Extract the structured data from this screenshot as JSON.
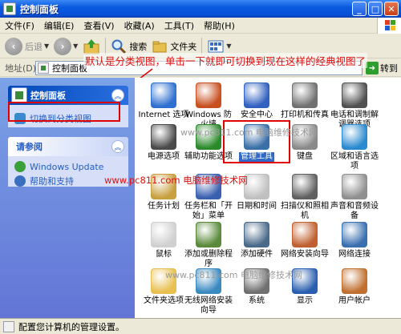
{
  "window": {
    "title": "控制面板"
  },
  "menu": [
    "文件(F)",
    "编辑(E)",
    "查看(V)",
    "收藏(A)",
    "工具(T)",
    "帮助(H)"
  ],
  "toolbar": {
    "back": "后退",
    "search": "搜索",
    "folders": "文件夹"
  },
  "address": {
    "label": "地址(D)",
    "value": "控制面板",
    "go": "转到"
  },
  "annotation": "默认是分类视图，单击一下就即可切换到现在这样的经典视图了",
  "left": {
    "control_panel": {
      "title": "控制面板",
      "link": "切换到分类视图"
    },
    "see_also": {
      "title": "请参阅",
      "links": [
        "Windows Update",
        "帮助和支持"
      ]
    }
  },
  "items": [
    {
      "label": "Internet 选项",
      "color": "#2E6FD0",
      "row": 0,
      "col": 0
    },
    {
      "label": "Windows 防火墙",
      "color": "#C85020",
      "row": 0,
      "col": 1
    },
    {
      "label": "安全中心",
      "color": "#3060C0",
      "row": 0,
      "col": 2
    },
    {
      "label": "打印机和传真",
      "color": "#707070",
      "row": 0,
      "col": 3
    },
    {
      "label": "电话和调制解调器选项",
      "color": "#505050",
      "row": 0,
      "col": 4
    },
    {
      "label": "电源选项",
      "color": "#4A4A4A",
      "row": 1,
      "col": 0
    },
    {
      "label": "辅助功能选项",
      "color": "#2C8A2C",
      "row": 1,
      "col": 1
    },
    {
      "label": "管理工具",
      "color": "#3A6FA8",
      "row": 1,
      "col": 2
    },
    {
      "label": "键盘",
      "color": "#8A8A8A",
      "row": 1,
      "col": 3
    },
    {
      "label": "区域和语言选项",
      "color": "#2A8ACF",
      "row": 1,
      "col": 4
    },
    {
      "label": "任务计划",
      "color": "#C8A040",
      "row": 2,
      "col": 0
    },
    {
      "label": "任务栏和「开始」菜单",
      "color": "#3A60B0",
      "row": 2,
      "col": 1
    },
    {
      "label": "日期和时间",
      "color": "#C0C0C0",
      "row": 2,
      "col": 2
    },
    {
      "label": "扫描仪和照相机",
      "color": "#606060",
      "row": 2,
      "col": 3
    },
    {
      "label": "声音和音频设备",
      "color": "#909090",
      "row": 2,
      "col": 4
    },
    {
      "label": "鼠标",
      "color": "#D0D0D0",
      "row": 3,
      "col": 0
    },
    {
      "label": "添加或删除程序",
      "color": "#5A8A3A",
      "row": 3,
      "col": 1
    },
    {
      "label": "添加硬件",
      "color": "#4A6A8A",
      "row": 3,
      "col": 2
    },
    {
      "label": "网络安装向导",
      "color": "#C06030",
      "row": 3,
      "col": 3
    },
    {
      "label": "网络连接",
      "color": "#3A70B0",
      "row": 3,
      "col": 4
    },
    {
      "label": "文件夹选项",
      "color": "#E8C050",
      "row": 4,
      "col": 0
    },
    {
      "label": "无线网络安装向导",
      "color": "#3A8AC0",
      "row": 4,
      "col": 1
    },
    {
      "label": "系统",
      "color": "#707070",
      "row": 4,
      "col": 2
    },
    {
      "label": "显示",
      "color": "#2A5FB0",
      "row": 4,
      "col": 3
    },
    {
      "label": "用户帐户",
      "color": "#C07030",
      "row": 4,
      "col": 4
    }
  ],
  "watermarks": {
    "gray": "www.pc811.com 电脑维修技术网",
    "red": "www.pc811.com 电脑维修技术网"
  },
  "status": "配置您计算机的管理设置。"
}
